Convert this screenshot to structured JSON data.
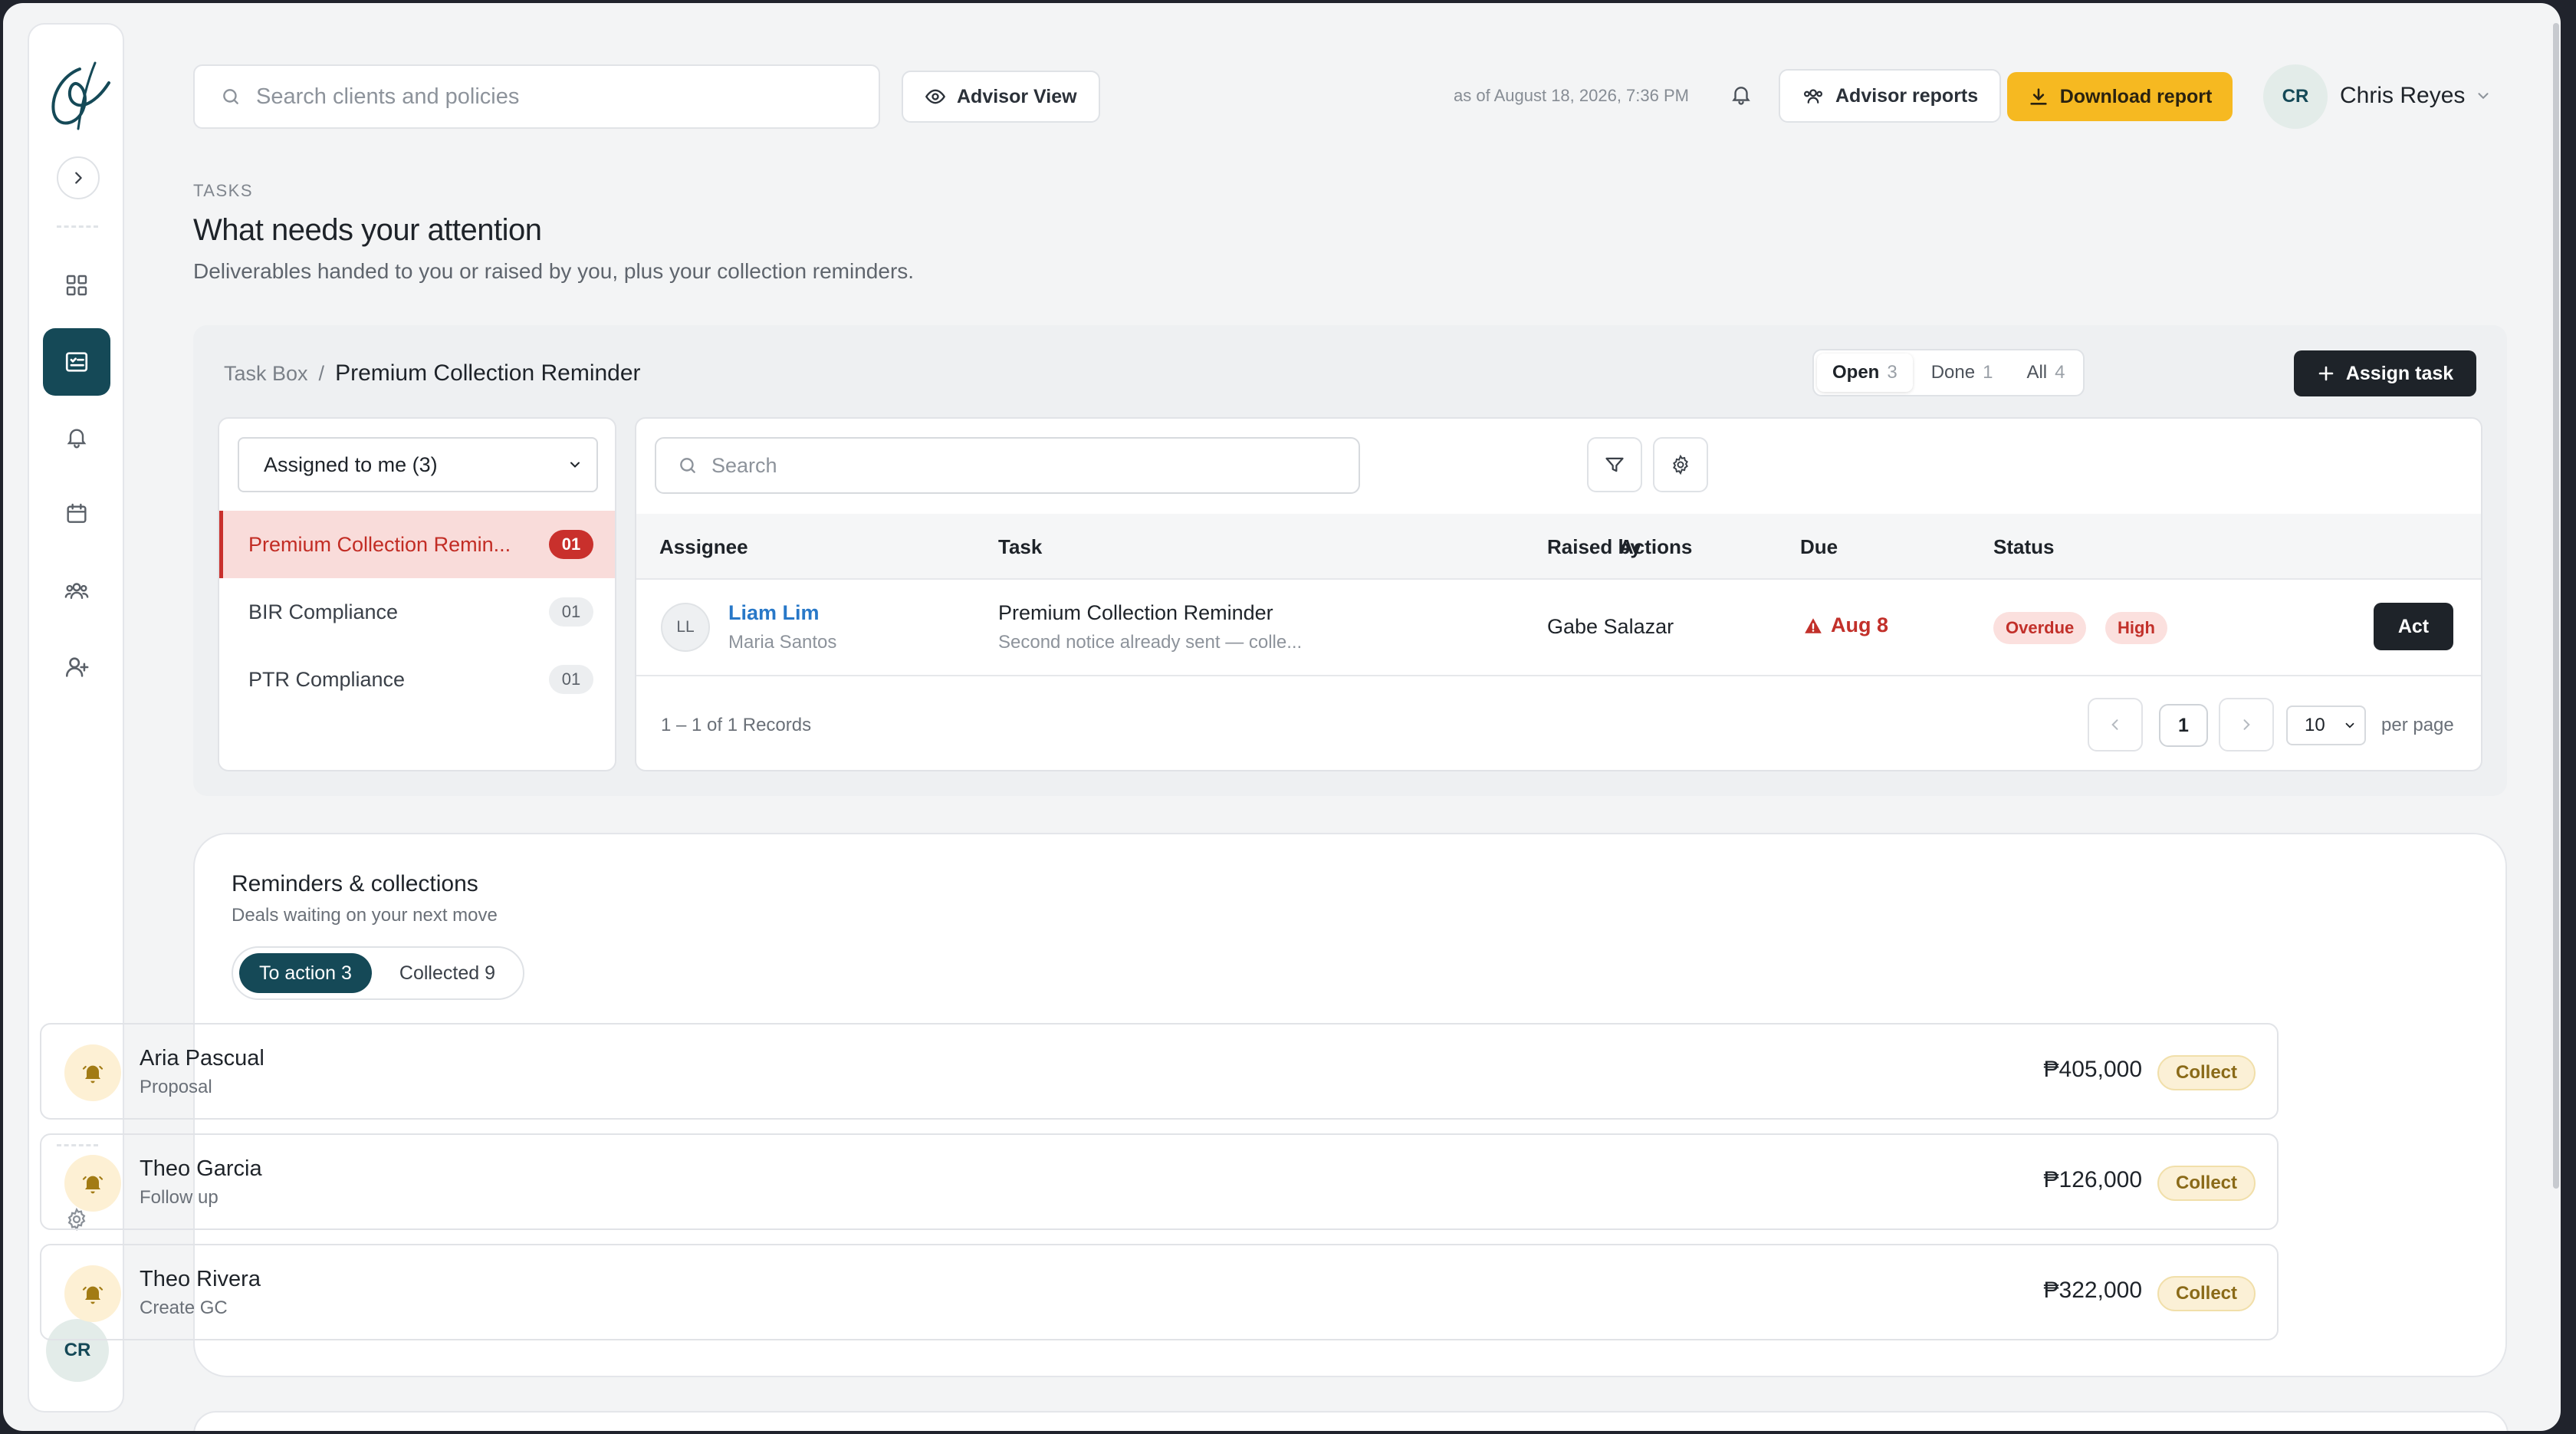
{
  "search": {
    "placeholder": "Search clients and policies"
  },
  "topbar": {
    "advisor_view": "Advisor View",
    "as_of": "as of August 18, 2026, 7:36 PM",
    "advisor_reports": "Advisor reports",
    "download_report": "Download report",
    "user_initials": "CR",
    "user_name": "Chris Reyes"
  },
  "sidebar": {
    "items": [
      {
        "icon": "dashboard-icon"
      },
      {
        "icon": "tasks-icon",
        "active": true
      },
      {
        "icon": "bell-icon"
      },
      {
        "icon": "calendar-icon"
      },
      {
        "icon": "team-icon"
      },
      {
        "icon": "add-user-icon"
      },
      {
        "icon": "settings-icon"
      },
      {
        "icon": "help-icon"
      }
    ],
    "avatar": "CR"
  },
  "heading": {
    "eyebrow": "TASKS",
    "title": "What needs your attention",
    "subtitle": "Deliverables handed to you or raised by you, plus your collection reminders."
  },
  "taskbox": {
    "breadcrumb_root": "Task Box",
    "breadcrumb_sep": "/",
    "breadcrumb_current": "Premium Collection Reminder",
    "tabs": [
      {
        "label": "Open",
        "count": "3",
        "active": true
      },
      {
        "label": "Done",
        "count": "1"
      },
      {
        "label": "All",
        "count": "4"
      }
    ],
    "assign_task": "Assign task",
    "filter_select": "Assigned to me (3)",
    "categories": [
      {
        "label": "Premium Collection Remin...",
        "count": "01",
        "active": true
      },
      {
        "label": "BIR Compliance",
        "count": "01"
      },
      {
        "label": "PTR Compliance",
        "count": "01"
      }
    ],
    "search_placeholder": "Search",
    "columns": [
      "Assignee",
      "Task",
      "Raised by",
      "Due",
      "Status",
      "Actions"
    ],
    "rows": [
      {
        "initials": "LL",
        "assignee": "Liam Lim",
        "client": "Maria Santos",
        "task": "Premium Collection Reminder",
        "task_sub": "Second notice already sent — colle...",
        "raised_by": "Gabe Salazar",
        "due": "Aug 8",
        "status": "Overdue",
        "priority": "High",
        "action": "Act"
      }
    ],
    "records": "1 – 1 of 1 Records",
    "page": "1",
    "per_page": "10",
    "per_page_label": "per page"
  },
  "reminders": {
    "title": "Reminders & collections",
    "subtitle": "Deals waiting on your next move",
    "tabs": [
      {
        "label": "To action 3",
        "active": true
      },
      {
        "label": "Collected 9"
      }
    ],
    "items": [
      {
        "name": "Aria Pascual",
        "stage": "Proposal",
        "amount": "₱405,000",
        "action": "Collect"
      },
      {
        "name": "Theo Garcia",
        "stage": "Follow up",
        "amount": "₱126,000",
        "action": "Collect"
      },
      {
        "name": "Theo Rivera",
        "stage": "Create GC",
        "amount": "₱322,000",
        "action": "Collect"
      }
    ]
  },
  "colors": {
    "brand_teal": "#154957",
    "accent_yellow": "#f6b921",
    "danger_red": "#c9302c",
    "link_blue": "#2878c8"
  }
}
